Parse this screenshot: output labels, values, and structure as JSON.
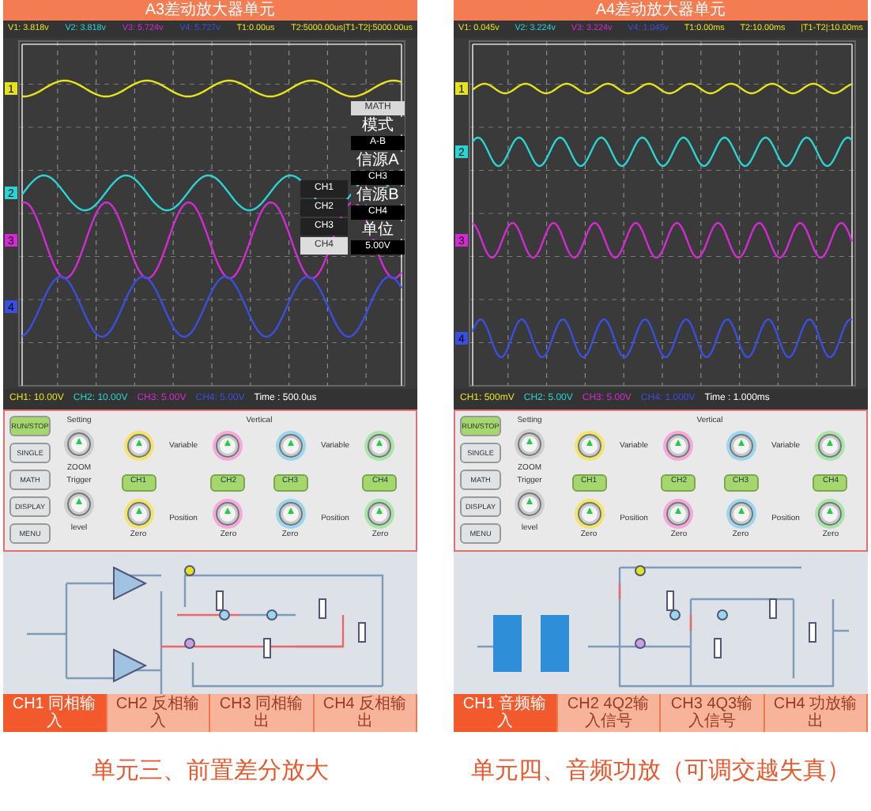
{
  "panels": [
    {
      "title": "A3差动放大器单元",
      "readouts": [
        {
          "label": "V1: 3.818v",
          "color": "#e6e21e"
        },
        {
          "label": "V2: 3.818v",
          "color": "#2ad4d4"
        },
        {
          "label": "V3: 5.724v",
          "color": "#d42ad4"
        },
        {
          "label": "V4: 5.727v",
          "color": "#3a4ee0"
        },
        {
          "label": "T1:0.00us",
          "color": "#e6e21e"
        },
        {
          "label": "T2:5000.00us|T1-T2|:5000.00us",
          "color": "#e6e21e"
        }
      ],
      "channel_markers": [
        {
          "label": "1",
          "color": "#e6e21e"
        },
        {
          "label": "2",
          "color": "#2ad4d4"
        },
        {
          "label": "3",
          "color": "#d42ad4"
        },
        {
          "label": "4",
          "color": "#3a4ee0"
        }
      ],
      "math_menu": {
        "side_items": [
          {
            "label": "CH1",
            "selected": false
          },
          {
            "label": "CH2",
            "selected": false
          },
          {
            "label": "CH3",
            "selected": false
          },
          {
            "label": "CH4",
            "selected": true
          }
        ],
        "items": [
          {
            "label": "MATH",
            "kind": "header"
          },
          {
            "label": "模式",
            "kind": "label"
          },
          {
            "label": "A-B",
            "kind": "value"
          },
          {
            "label": "信源A",
            "kind": "label"
          },
          {
            "label": "CH3",
            "kind": "value"
          },
          {
            "label": "信源B",
            "kind": "label"
          },
          {
            "label": "CH4",
            "kind": "value"
          },
          {
            "label": "单位",
            "kind": "label"
          },
          {
            "label": "5.00V",
            "kind": "value"
          }
        ]
      },
      "scale_readouts": [
        {
          "label": "CH1: 10.00V",
          "color": "#e6e21e"
        },
        {
          "label": "CH2: 10.00V",
          "color": "#2ad4d4"
        },
        {
          "label": "CH3: 5.00V",
          "color": "#d42ad4"
        },
        {
          "label": "CH4: 5.00V",
          "color": "#3a4ee0"
        },
        {
          "label": "Time : 500.0us",
          "color": "#ffffff"
        }
      ],
      "controls": {
        "side_buttons": [
          {
            "label": "RUN/STOP",
            "active": true
          },
          {
            "label": "SINGLE",
            "active": false
          },
          {
            "label": "MATH",
            "active": false
          },
          {
            "label": "DISPLAY",
            "active": false
          },
          {
            "label": "MENU",
            "active": false
          }
        ],
        "setting_label": "Setting",
        "zoom_label": "ZOOM",
        "trigger_label": "Trigger",
        "level_label": "level",
        "vertical_label": "Vertical",
        "channel_buttons": [
          "CH1",
          "CH2",
          "CH3",
          "CH4"
        ],
        "variable_labels": [
          "Variable",
          "Variable"
        ],
        "position_labels": [
          "Position",
          "Position"
        ],
        "zero_labels": [
          "Zero",
          "Zero",
          "Zero",
          "Zero"
        ]
      },
      "tabs": [
        {
          "label": "CH1 同相输入",
          "selected": true
        },
        {
          "label": "CH2 反相输入",
          "selected": false
        },
        {
          "label": "CH3 同相输出",
          "selected": false
        },
        {
          "label": "CH4 反相输出",
          "selected": false
        }
      ],
      "caption": "单元三、前置差分放大"
    },
    {
      "title": "A4差动放大器单元",
      "readouts": [
        {
          "label": "V1: 0.045v",
          "color": "#e6e21e"
        },
        {
          "label": "V2: 3.224v",
          "color": "#2ad4d4"
        },
        {
          "label": "V3: 3.224v",
          "color": "#d42ad4"
        },
        {
          "label": "V4: 1.045v",
          "color": "#3a4ee0"
        },
        {
          "label": "T1:0.00ms",
          "color": "#e6e21e"
        },
        {
          "label": "T2:10.00ms",
          "color": "#e6e21e"
        },
        {
          "label": "|T1-T2|:10.00ms",
          "color": "#e6e21e"
        }
      ],
      "channel_markers": [
        {
          "label": "1",
          "color": "#e6e21e"
        },
        {
          "label": "2",
          "color": "#2ad4d4"
        },
        {
          "label": "3",
          "color": "#d42ad4"
        },
        {
          "label": "4",
          "color": "#3a4ee0"
        }
      ],
      "scale_readouts": [
        {
          "label": "CH1: 500mV",
          "color": "#e6e21e"
        },
        {
          "label": "CH2: 5.00V",
          "color": "#2ad4d4"
        },
        {
          "label": "CH3: 5.00V",
          "color": "#d42ad4"
        },
        {
          "label": "CH4: 1.000V",
          "color": "#3a4ee0"
        },
        {
          "label": "Time : 1.000ms",
          "color": "#ffffff"
        }
      ],
      "controls": {
        "side_buttons": [
          {
            "label": "RUN/STOP",
            "active": true
          },
          {
            "label": "SINGLE",
            "active": false
          },
          {
            "label": "MATH",
            "active": false
          },
          {
            "label": "DISPLAY",
            "active": false
          },
          {
            "label": "MENU",
            "active": false
          }
        ],
        "setting_label": "Setting",
        "zoom_label": "ZOOM",
        "trigger_label": "Trigger",
        "level_label": "level",
        "vertical_label": "Vertical",
        "channel_buttons": [
          "CH1",
          "CH2",
          "CH3",
          "CH4"
        ],
        "variable_labels": [
          "Variable",
          "Variable"
        ],
        "position_labels": [
          "Position",
          "Position"
        ],
        "zero_labels": [
          "Zero",
          "Zero",
          "Zero",
          "Zero"
        ]
      },
      "tabs": [
        {
          "label": "CH1 音频输入",
          "selected": true
        },
        {
          "label": "CH2 4Q2输入信号",
          "selected": false
        },
        {
          "label": "CH3 4Q3输入信号",
          "selected": false
        },
        {
          "label": "CH4 功放输出",
          "selected": false
        }
      ],
      "caption": "单元四、音频功放（可调交越失真）"
    }
  ]
}
